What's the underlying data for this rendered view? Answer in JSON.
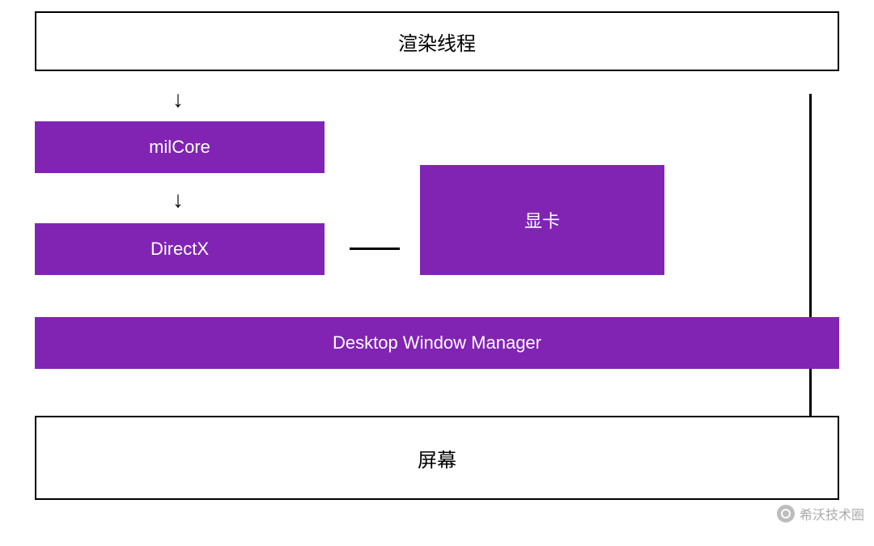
{
  "nodes": {
    "render_thread": "渲染线程",
    "milcore": "milCore",
    "directx": "DirectX",
    "gpu": "显卡",
    "dwm": "Desktop Window Manager",
    "screen": "屏幕"
  },
  "watermark": {
    "text": "希沃技术圈"
  },
  "colors": {
    "purple": "#8124b3"
  }
}
